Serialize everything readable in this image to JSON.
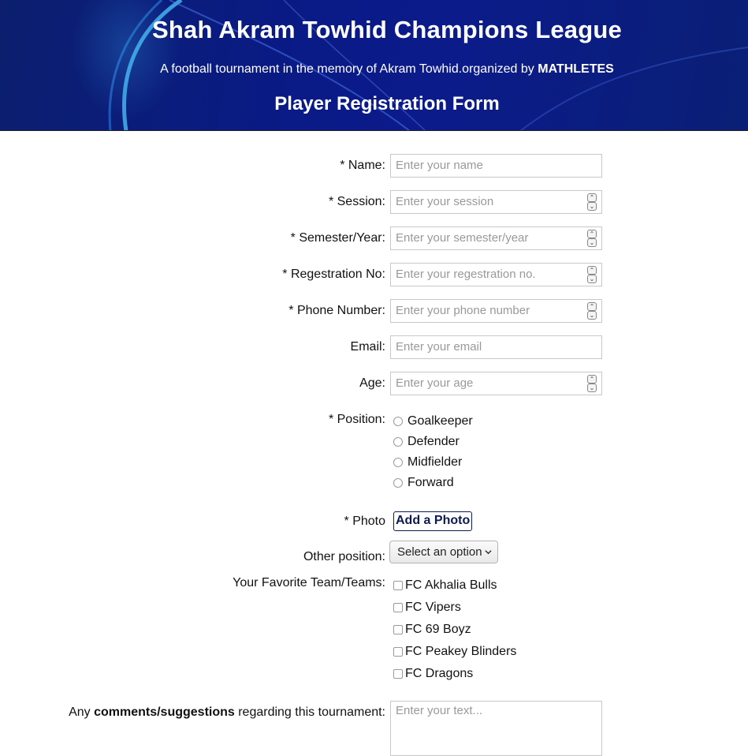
{
  "header": {
    "title": "Shah Akram Towhid Champions League",
    "subtitle_prefix": "A football tournament in the memory of Akram Towhid.organized by ",
    "subtitle_org": "MATHLETES",
    "form_title": "Player Registration Form"
  },
  "fields": {
    "name": {
      "label": "* Name:",
      "placeholder": "Enter your name"
    },
    "session": {
      "label": "* Session:",
      "placeholder": "Enter your session"
    },
    "semester": {
      "label": "* Semester/Year:",
      "placeholder": "Enter your semester/year"
    },
    "registration": {
      "label": "* Regestration No:",
      "placeholder": "Enter your regestration no."
    },
    "phone": {
      "label": "* Phone Number:",
      "placeholder": "Enter your phone number"
    },
    "email": {
      "label": "Email:",
      "placeholder": "Enter your email"
    },
    "age": {
      "label": "Age:",
      "placeholder": "Enter your age"
    }
  },
  "position": {
    "label": "* Position:",
    "options": [
      "Goalkeeper",
      "Defender",
      "Midfielder",
      "Forward"
    ]
  },
  "photo": {
    "label": "* Photo",
    "button": "Add a Photo"
  },
  "other_position": {
    "label": "Other position:",
    "selected": "Select an option"
  },
  "teams": {
    "label": "Your Favorite Team/Teams:",
    "options": [
      "FC Akhalia Bulls",
      "FC Vipers",
      "FC 69 Boyz",
      "FC Peakey Blinders",
      "FC Dragons"
    ]
  },
  "comments": {
    "label_prefix": "Any ",
    "label_bold": "comments/suggestions",
    "label_suffix": " regarding this tournament:",
    "placeholder": "Enter your text..."
  },
  "colors": {
    "header_bg": "#0a1a86",
    "button_border": "#0d1b4f"
  },
  "icons": {
    "spinner": "spinner-arrows-icon",
    "select": "chevron-down-icon"
  }
}
